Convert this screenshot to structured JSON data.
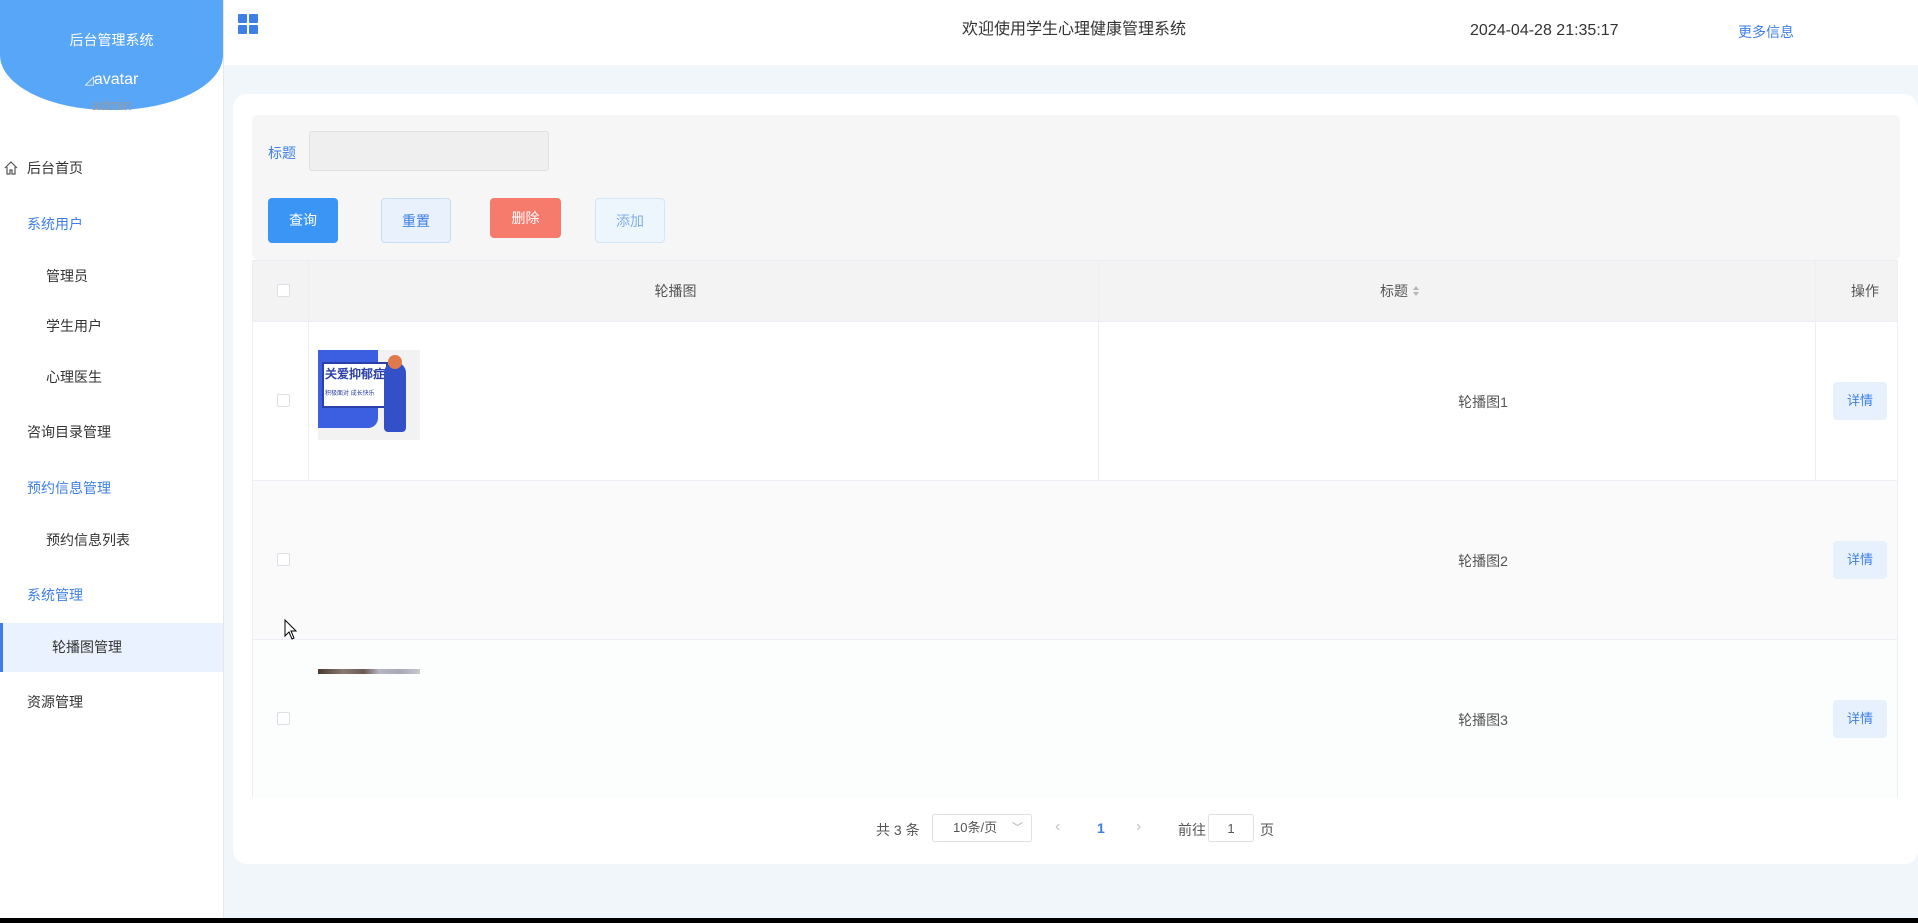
{
  "sidebar": {
    "brand_title": "后台管理系统",
    "avatar_alt": "avatar",
    "username": "admin",
    "items": [
      {
        "label": "后台首页"
      },
      {
        "label": "系统用户"
      },
      {
        "label": "管理员"
      },
      {
        "label": "学生用户"
      },
      {
        "label": "心理医生"
      },
      {
        "label": "咨询目录管理"
      },
      {
        "label": "预约信息管理"
      },
      {
        "label": "预约信息列表"
      },
      {
        "label": "系统管理"
      },
      {
        "label": "轮播图管理"
      },
      {
        "label": "资源管理"
      }
    ]
  },
  "header": {
    "welcome": "欢迎使用学生心理健康管理系统",
    "datetime": "2024-04-28 21:35:17",
    "more_info": "更多信息"
  },
  "search": {
    "label": "标题",
    "value": "",
    "buttons": {
      "query": "查询",
      "reset": "重置",
      "delete": "删除",
      "add": "添加"
    }
  },
  "table": {
    "columns": {
      "image": "轮播图",
      "title": "标题",
      "actions": "操作"
    },
    "rows": [
      {
        "title": "轮播图1",
        "action": "详情",
        "image_text_1": "关爱抑郁症",
        "image_text_2": "积极面对 成长快乐"
      },
      {
        "title": "轮播图2",
        "action": "详情"
      },
      {
        "title": "轮播图3",
        "action": "详情"
      }
    ]
  },
  "pagination": {
    "total": "共 3 条",
    "page_size": "10条/页",
    "current_page": "1",
    "goto_label": "前往",
    "goto_value": "1",
    "page_unit": "页"
  },
  "colors": {
    "accent": "#3d7fe6",
    "brand": "#58a6f7",
    "danger": "#f77b6c",
    "query": "#3a95f5"
  }
}
